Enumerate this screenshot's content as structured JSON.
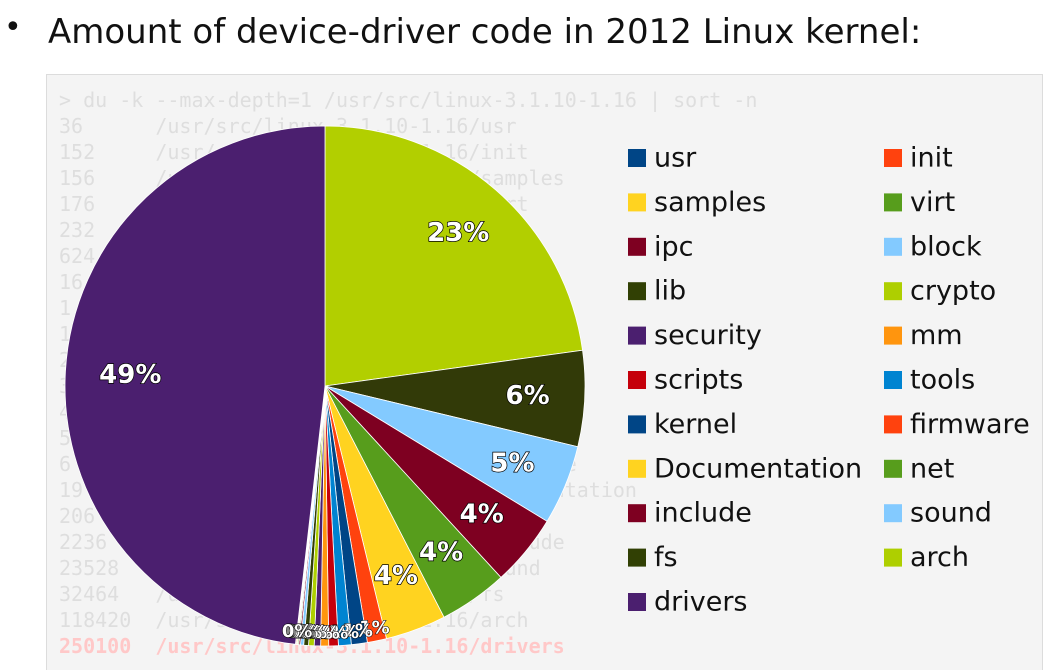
{
  "heading": {
    "bullet": "•",
    "text": "Amount of device-driver code in 2012 Linux kernel:"
  },
  "terminal": {
    "lines": [
      "> du -k --max-depth=1 /usr/src/linux-3.1.10-1.16 | sort -n",
      "36      /usr/src/linux-3.1.10-1.16/usr",
      "152     /usr/src/linux-3.1.10-1.16/init",
      "156     /usr/src/linux-3.1.10-1.16/samples",
      "176     /usr/src/linux-3.1.10-1.16/virt",
      "232     /usr/src/linux-3.1.10-1.16/ipc",
      "624     /usr/src/linux-3.1.10-1.16/block",
      "16      /usr/src/linux-3.1.10-1.16/lib",
      "1       /usr/src/linux-3.1.10-1.16/crypto",
      "1       /usr/src/linux-3.1.10-1.16/security",
      "2       /usr/src/linux-3.1.10-1.16/mm",
      "3       /usr/src/linux-3.1.10-1.16/scripts",
      "4       /usr/src/linux-3.1.10-1.16/tools",
      "5       /usr/src/linux-3.1.10-1.16/kernel",
      "6       /usr/src/linux-3.1.10-1.16/firmware",
      "19      /usr/src/linux-3.1.10-1.16/Documentation",
      "206     /usr/src/linux-3.1.10-1.16/net",
      "2236    /usr/src/linux-3.1.10-1.16/include",
      "23528   /usr/src/linux-3.1.10-1.16/sound",
      "32464   /usr/src/linux-3.1.10-1.16/fs",
      "118420  /usr/src/linux-3.1.10-1.16/arch",
      "250100  /usr/src/linux-3.1.10-1.16/drivers"
    ],
    "highlight_index": 21
  },
  "chart_data": {
    "type": "pie",
    "title": "",
    "start_angle_deg": 0,
    "direction": "clockwise",
    "slices": [
      {
        "name": "arch",
        "value": 23,
        "color": "#b2cf00",
        "label": "23%"
      },
      {
        "name": "fs",
        "value": 6,
        "color": "#323a08",
        "label": "6%"
      },
      {
        "name": "sound",
        "value": 5,
        "color": "#83caff",
        "label": "5%"
      },
      {
        "name": "include",
        "value": 4.5,
        "color": "#7e0021",
        "label": "4%"
      },
      {
        "name": "net",
        "value": 4.3,
        "color": "#579d1c",
        "label": "4%"
      },
      {
        "name": "Documentation",
        "value": 3.8,
        "color": "#ffd320",
        "label": "4%"
      },
      {
        "name": "firmware",
        "value": 1.2,
        "color": "#ff420e",
        "label": "1%"
      },
      {
        "name": "kernel",
        "value": 1.0,
        "color": "#004586",
        "label": "1%"
      },
      {
        "name": "tools",
        "value": 0.8,
        "color": "#0084d1",
        "label": "1%"
      },
      {
        "name": "scripts",
        "value": 0.6,
        "color": "#c5000b",
        "label": "1%"
      },
      {
        "name": "mm",
        "value": 0.5,
        "color": "#ff950e",
        "label": "0%"
      },
      {
        "name": "security",
        "value": 0.4,
        "color": "#4b1f6f",
        "label": "0%"
      },
      {
        "name": "crypto",
        "value": 0.35,
        "color": "#aecf00",
        "label": "0%"
      },
      {
        "name": "lib",
        "value": 0.3,
        "color": "#314004",
        "label": "0%"
      },
      {
        "name": "block",
        "value": 0.2,
        "color": "#83caff",
        "label": "0%"
      },
      {
        "name": "ipc",
        "value": 0.1,
        "color": "#7e0021",
        "label": "0%"
      },
      {
        "name": "virt",
        "value": 0.07,
        "color": "#579d1c",
        "label": "0%"
      },
      {
        "name": "samples",
        "value": 0.06,
        "color": "#ffd320",
        "label": "0%"
      },
      {
        "name": "init",
        "value": 0.06,
        "color": "#ff420e",
        "label": "0%"
      },
      {
        "name": "usr",
        "value": 0.02,
        "color": "#004586",
        "label": "0%"
      },
      {
        "name": "drivers",
        "value": 48.6,
        "color": "#4b1f6f",
        "label": "49%"
      }
    ],
    "legend": {
      "placement": "right",
      "entries": [
        {
          "name": "usr",
          "color": "#004586"
        },
        {
          "name": "init",
          "color": "#ff420e"
        },
        {
          "name": "samples",
          "color": "#ffd320"
        },
        {
          "name": "virt",
          "color": "#579d1c"
        },
        {
          "name": "ipc",
          "color": "#7e0021"
        },
        {
          "name": "block",
          "color": "#83caff"
        },
        {
          "name": "lib",
          "color": "#314004"
        },
        {
          "name": "crypto",
          "color": "#aecf00"
        },
        {
          "name": "security",
          "color": "#4b1f6f"
        },
        {
          "name": "mm",
          "color": "#ff950e"
        },
        {
          "name": "scripts",
          "color": "#c5000b"
        },
        {
          "name": "tools",
          "color": "#0084d1"
        },
        {
          "name": "kernel",
          "color": "#004586"
        },
        {
          "name": "firmware",
          "color": "#ff420e"
        },
        {
          "name": "Documentation",
          "color": "#ffd320"
        },
        {
          "name": "net",
          "color": "#579d1c"
        },
        {
          "name": "include",
          "color": "#7e0021"
        },
        {
          "name": "sound",
          "color": "#83caff"
        },
        {
          "name": "fs",
          "color": "#314004"
        },
        {
          "name": "arch",
          "color": "#aecf00"
        },
        {
          "name": "drivers",
          "color": "#4b1f6f"
        }
      ]
    }
  }
}
